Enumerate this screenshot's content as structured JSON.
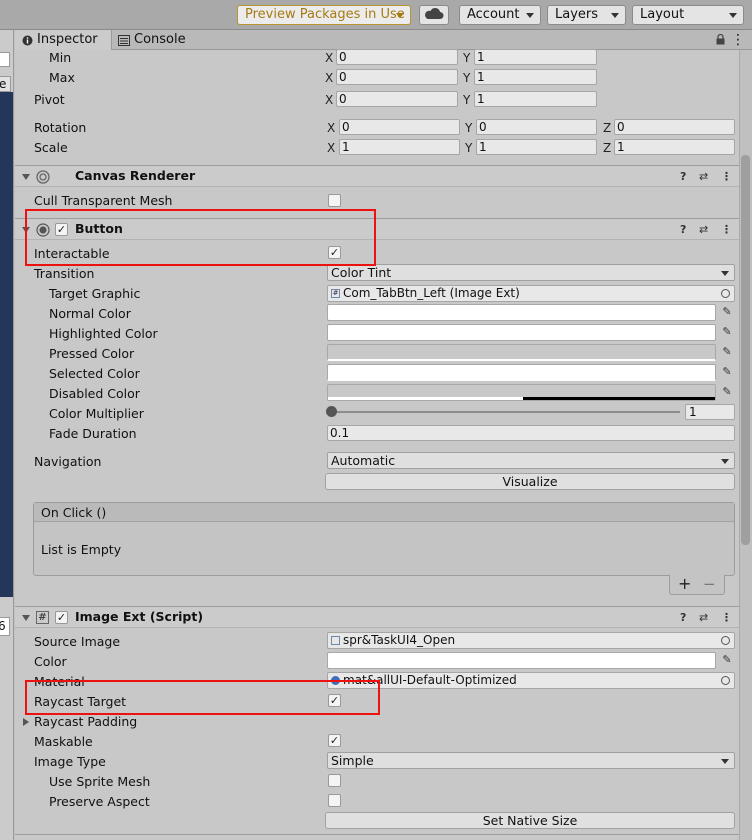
{
  "toolbar": {
    "preview_packages": "Preview Packages in Use",
    "account": "Account",
    "layers": "Layers",
    "layout": "Layout"
  },
  "left_panel": {
    "field_text": "e",
    "field_text2": "6"
  },
  "tabs": {
    "inspector": "Inspector",
    "console": "Console"
  },
  "rect_transform": {
    "anchors_min": {
      "label": "Min",
      "x": "0",
      "y": "1"
    },
    "anchors_max": {
      "label": "Max",
      "x": "0",
      "y": "1"
    },
    "pivot": {
      "label": "Pivot",
      "x": "0",
      "y": "1"
    },
    "rotation": {
      "label": "Rotation",
      "x": "0",
      "y": "0",
      "z": "0"
    },
    "scale": {
      "label": "Scale",
      "x": "1",
      "y": "1",
      "z": "1"
    }
  },
  "axes": {
    "x": "X",
    "y": "Y",
    "z": "Z"
  },
  "canvas_renderer": {
    "title": "Canvas Renderer",
    "cull_transparent_mesh": {
      "label": "Cull Transparent Mesh",
      "checked": false
    }
  },
  "button": {
    "title": "Button",
    "interactable": {
      "label": "Interactable",
      "checked": true
    },
    "transition": {
      "label": "Transition",
      "value": "Color Tint"
    },
    "target_graphic": {
      "label": "Target Graphic",
      "value": "Com_TabBtn_Left (Image Ext)"
    },
    "normal_color": {
      "label": "Normal Color"
    },
    "highlighted_color": {
      "label": "Highlighted Color"
    },
    "pressed_color": {
      "label": "Pressed Color"
    },
    "selected_color": {
      "label": "Selected Color"
    },
    "disabled_color": {
      "label": "Disabled Color"
    },
    "color_multiplier": {
      "label": "Color Multiplier",
      "value": "1"
    },
    "fade_duration": {
      "label": "Fade Duration",
      "value": "0.1"
    },
    "navigation": {
      "label": "Navigation",
      "value": "Automatic"
    },
    "visualize": "Visualize",
    "on_click": {
      "title": "On Click ()",
      "empty_text": "List is Empty",
      "add": "+",
      "remove": "−"
    }
  },
  "image_ext": {
    "title": "Image Ext (Script)",
    "source_image": {
      "label": "Source Image",
      "value": "spr&TaskUI4_Open"
    },
    "color": {
      "label": "Color"
    },
    "material": {
      "label": "Material",
      "value": "mat&allUI-Default-Optimized"
    },
    "raycast_target": {
      "label": "Raycast Target",
      "checked": true
    },
    "raycast_padding": {
      "label": "Raycast Padding"
    },
    "maskable": {
      "label": "Maskable",
      "checked": true
    },
    "image_type": {
      "label": "Image Type",
      "value": "Simple"
    },
    "use_sprite_mesh": {
      "label": "Use Sprite Mesh",
      "checked": false
    },
    "preserve_aspect": {
      "label": "Preserve Aspect",
      "checked": false
    },
    "set_native_size": "Set Native Size"
  },
  "icons": {
    "help": "?",
    "presets": "⇄",
    "menu": "⋮",
    "checkmark": "✓",
    "eyedropper": "✎",
    "script": "#",
    "lock": "🔒"
  },
  "colors": {
    "highlight_box": "#ee1111",
    "preview_text": "#a67a12",
    "hierarchy_bg": "#24375a"
  }
}
